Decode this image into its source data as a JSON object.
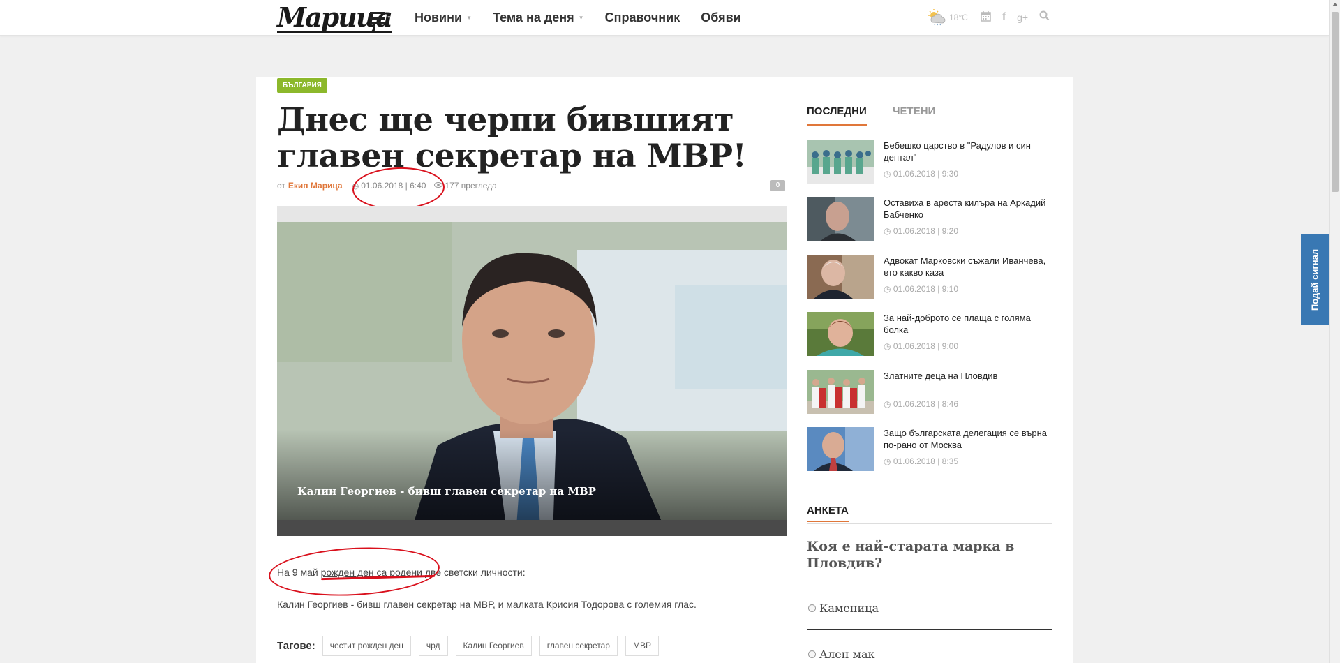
{
  "header": {
    "logo": "Марица",
    "nav": [
      {
        "label": "Новини",
        "caret": true
      },
      {
        "label": "Тема на деня",
        "caret": true
      },
      {
        "label": "Справочник",
        "caret": false
      },
      {
        "label": "Обяви",
        "caret": false
      }
    ],
    "temperature": "18°C",
    "icons": [
      "weather-icon",
      "calendar-icon",
      "facebook-icon",
      "google-plus-icon",
      "search-icon"
    ]
  },
  "article": {
    "category": "БЪЛГАРИЯ",
    "title": "Днес ще черпи бившият главен секретар на МВР!",
    "author_prefix": "от",
    "author": "Екип Марица",
    "date": "01.06.2018 | 6:40",
    "views": "177 прегледа",
    "comments": "0",
    "image_caption": "Калин Георгиев - бивш главен секретар на МВР",
    "paragraph1": {
      "before": "На 9 май ",
      "underlined": "рожден ден са родени",
      "after": " две светски личности:"
    },
    "paragraph2": "Калин Георгиев - бивш главен секретар на МВР, и малката Крисия Тодорова с големия глас.",
    "tags_label": "Тагове:",
    "tags": [
      "честит рожден ден",
      "чрд",
      "Калин Георгиев",
      "главен секретар",
      "МВР"
    ]
  },
  "sidebar": {
    "tabs": [
      "ПОСЛЕДНИ",
      "ЧЕТЕНИ"
    ],
    "news": [
      {
        "title": "Бебешко царство в \"Радулов и син дентал\"",
        "time": "01.06.2018 | 9:30"
      },
      {
        "title": "Оставиха в ареста килъра на Аркадий Бабченко",
        "time": "01.06.2018 | 9:20"
      },
      {
        "title": "Адвокат Марковски съжали Иванчева, ето какво каза",
        "time": "01.06.2018 | 9:10"
      },
      {
        "title": "За най-доброто се плаща с голяма болка",
        "time": "01.06.2018 | 9:00"
      },
      {
        "title": "Златните деца на Пловдив",
        "time": "01.06.2018 | 8:46"
      },
      {
        "title": "Защо българската делегация се върна по-рано от Москва",
        "time": "01.06.2018 | 8:35"
      }
    ],
    "poll": {
      "heading": "АНКЕТА",
      "question": "Коя е най-старата марка в Пловдив?",
      "options": [
        "Каменица",
        "Ален мак"
      ]
    }
  },
  "signal_button": "Подай сигнал",
  "colors": {
    "accent": "#e0773a",
    "category_badge": "#8cb82b",
    "signal_button": "#3978b3",
    "annotation_red": "#d9101c"
  }
}
